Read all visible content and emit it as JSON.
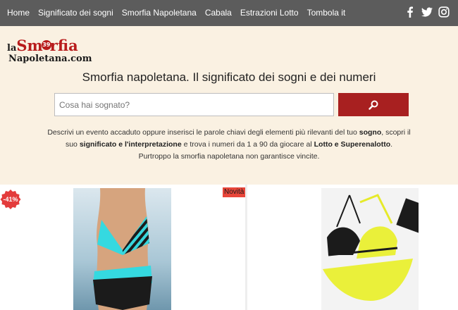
{
  "nav": {
    "items": [
      "Home",
      "Significato dei sogni",
      "Smorfia Napoletana",
      "Cabala",
      "Estrazioni Lotto",
      "Tombola it"
    ],
    "social": [
      "facebook-icon",
      "twitter-icon",
      "instagram-icon"
    ]
  },
  "logo": {
    "line1_prefix": "la",
    "line1_red_a": "Sm",
    "badge": "39",
    "line1_red_b": "rfia",
    "line2": "Napoletana.com"
  },
  "hero": {
    "title": "Smorfia napoletana. Il significato dei sogni e dei numeri",
    "search_placeholder": "Cosa hai sognato?",
    "desc": {
      "p1": "Descrivi un evento accaduto oppure inserisci le parole chiavi degli elementi più rilevanti del tuo ",
      "b1": "sogno",
      "p2": ", scopri il suo ",
      "b2": "significato e l'interpretazione",
      "p3": " e trova i numeri da 1 a 90 da giocare al ",
      "b3": "Lotto e Superenalotto",
      "p4": ".",
      "line3": "Purtroppo la smorfia napoletana non garantisce vincite."
    }
  },
  "products": {
    "discount": "-41%",
    "badge_new": "Novità"
  },
  "colors": {
    "nav_bg": "#5c5c5c",
    "hero_bg": "#faf1e2",
    "brand_red": "#a82020",
    "novita_bg": "#e8463a"
  }
}
